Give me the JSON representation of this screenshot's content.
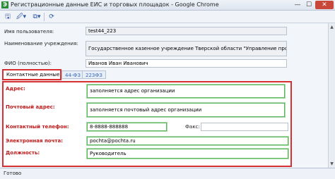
{
  "window": {
    "title": "Регистрационные данные ЕИС и торговых площадок - Google Chrome",
    "app_icon": "Э",
    "minimize_glyph": "—",
    "maximize_glyph": "☐",
    "close_glyph": "✕"
  },
  "toolbar": {
    "save_icon": "🖫",
    "attach_icon": "🖉▾",
    "copy_icon": "⧉▾",
    "refresh_icon": "⟳"
  },
  "form": {
    "username_label": "Имя пользователя:",
    "username_value": "test44_223",
    "org_label": "Наименование учреждения:",
    "org_value": "Государственное казенное учреждение Тверской области \"Управление противопо",
    "fio_label": "ФИО (полностью):",
    "fio_value": "Иванов Иван Иванович"
  },
  "tabs": [
    {
      "label": "Контактные данные",
      "active": true
    },
    {
      "label": "44-ФЗ",
      "active": false
    },
    {
      "label": "223ФЗ",
      "active": false
    }
  ],
  "contact": {
    "address_label": "Адрес:",
    "address_value": "заполняется адрес организации",
    "postal_label": "Почтовый адрес:",
    "postal_value": "заполняется почтовый адрес организации",
    "phone_label": "Контактный телефон:",
    "phone_value": "8-8888-888888",
    "fax_label": "Факс:",
    "fax_value": "",
    "email_label": "Электронная почта:",
    "email_value": "pochta@pochta.ru",
    "position_label": "Должность:",
    "position_value": "Руководитель"
  },
  "scrollbar": {
    "up_glyph": "▲",
    "down_glyph": "▼"
  },
  "status": {
    "text": "Готово"
  },
  "colors": {
    "highlight_red": "#d63030",
    "label_red": "#c01818",
    "field_green": "#5cb85c"
  }
}
